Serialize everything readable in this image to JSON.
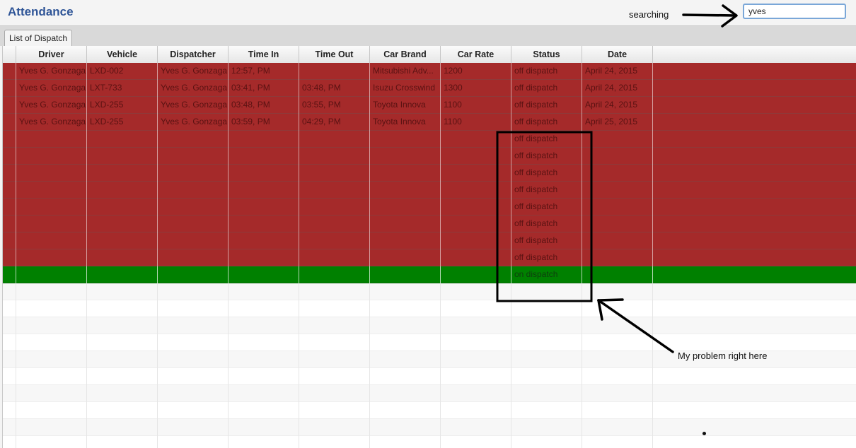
{
  "app": {
    "title": "Attendance"
  },
  "search": {
    "label": "searching",
    "value": "yves"
  },
  "tabs": [
    {
      "label": "List of Dispatch"
    }
  ],
  "table": {
    "columns": [
      "Driver",
      "Vehicle",
      "Dispatcher",
      "Time In",
      "Time Out",
      "Car Brand",
      "Car Rate",
      "Status",
      "Date"
    ],
    "rows": [
      [
        "Yves G. Gonzaga",
        "LXD-002",
        "Yves G. Gonzaga",
        "12:57, PM",
        "",
        "Mitsubishi Adv...",
        "1200",
        "off dispatch",
        "April 24, 2015"
      ],
      [
        "Yves G. Gonzaga",
        "LXT-733",
        "Yves G. Gonzaga",
        "03:41, PM",
        "03:48, PM",
        "Isuzu Crosswind",
        "1300",
        "off dispatch",
        "April 24, 2015"
      ],
      [
        "Yves G. Gonzaga",
        "LXD-255",
        "Yves G. Gonzaga",
        "03:48, PM",
        "03:55, PM",
        "Toyota Innova",
        "1100",
        "off dispatch",
        "April 24, 2015"
      ],
      [
        "Yves G. Gonzaga",
        "LXD-255",
        "Yves G. Gonzaga",
        "03:59, PM",
        "04:29, PM",
        "Toyota Innova",
        "1100",
        "off dispatch",
        "April 25, 2015"
      ],
      [
        "",
        "",
        "",
        "",
        "",
        "",
        "",
        "off dispatch",
        ""
      ],
      [
        "",
        "",
        "",
        "",
        "",
        "",
        "",
        "off dispatch",
        ""
      ],
      [
        "",
        "",
        "",
        "",
        "",
        "",
        "",
        "off dispatch",
        ""
      ],
      [
        "",
        "",
        "",
        "",
        "",
        "",
        "",
        "off dispatch",
        ""
      ],
      [
        "",
        "",
        "",
        "",
        "",
        "",
        "",
        "off dispatch",
        ""
      ],
      [
        "",
        "",
        "",
        "",
        "",
        "",
        "",
        "off dispatch",
        ""
      ],
      [
        "",
        "",
        "",
        "",
        "",
        "",
        "",
        "off dispatch",
        ""
      ],
      [
        "",
        "",
        "",
        "",
        "",
        "",
        "",
        "off dispatch",
        ""
      ],
      [
        "",
        "",
        "",
        "",
        "",
        "",
        "",
        "on dispatch",
        ""
      ]
    ],
    "empty_rows": 10,
    "colors": {
      "off_dispatch": "#a52a2a",
      "on_dispatch": "#008000"
    }
  },
  "annotations": {
    "problem_text": "My problem right here"
  }
}
